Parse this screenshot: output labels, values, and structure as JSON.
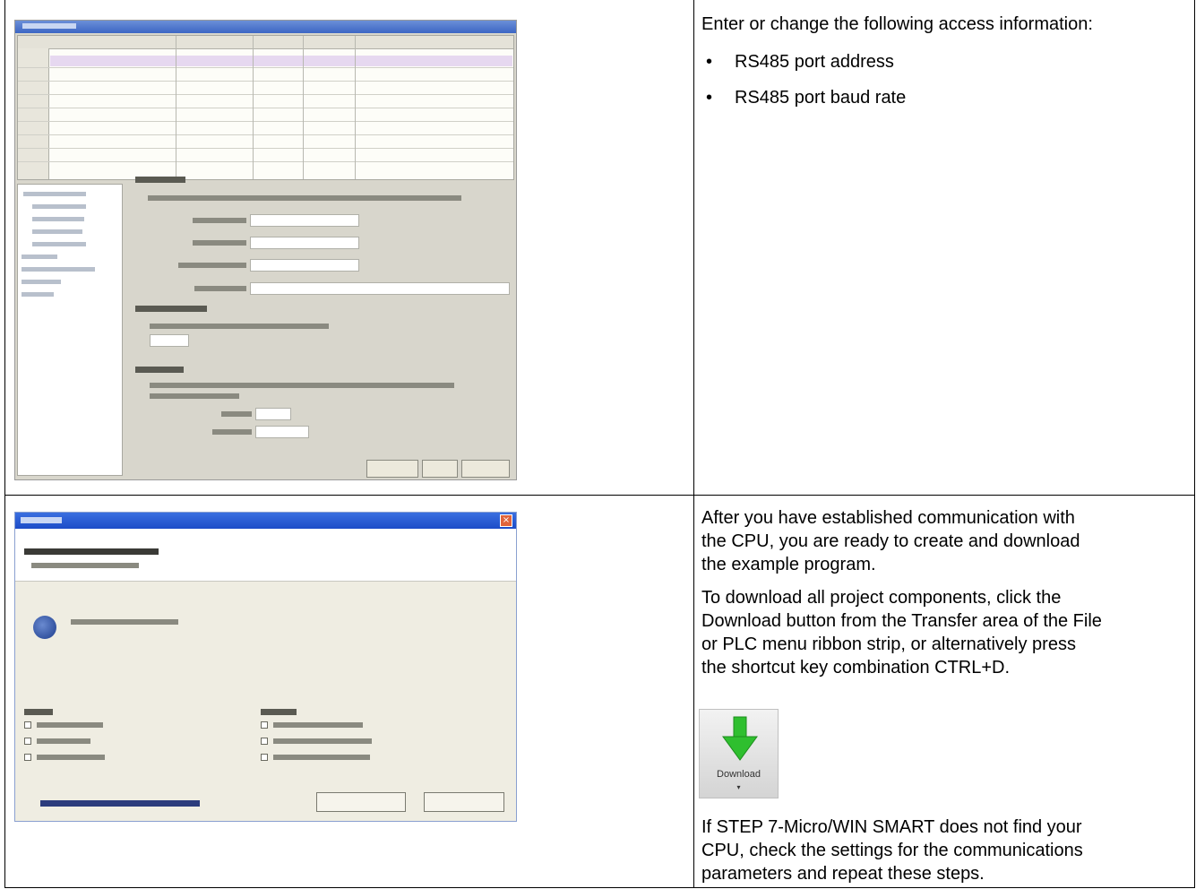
{
  "row1": {
    "intro": "Enter or change the following access information:",
    "bullets": [
      "RS485 port address",
      "RS485 port baud rate"
    ],
    "bullet_glyph": "•"
  },
  "row2": {
    "para1_lines": [
      "After you have established communication with",
      "the CPU, you are ready to create and download",
      "the example program."
    ],
    "para2_lines": [
      "To download all project components, click the",
      "Download button from the Transfer area of the File",
      "or PLC menu ribbon strip, or alternatively press",
      "the shortcut key combination CTRL+D."
    ],
    "download_icon": {
      "icon": "download-arrow-icon",
      "label": "Download",
      "arrow_color": "#2fbf2f"
    },
    "para3_lines": [
      "If STEP 7-Micro/WIN SMART does not find your",
      "CPU, check the settings for the communications",
      "parameters and repeat these steps."
    ]
  },
  "dialog": {
    "close_glyph": "×"
  }
}
